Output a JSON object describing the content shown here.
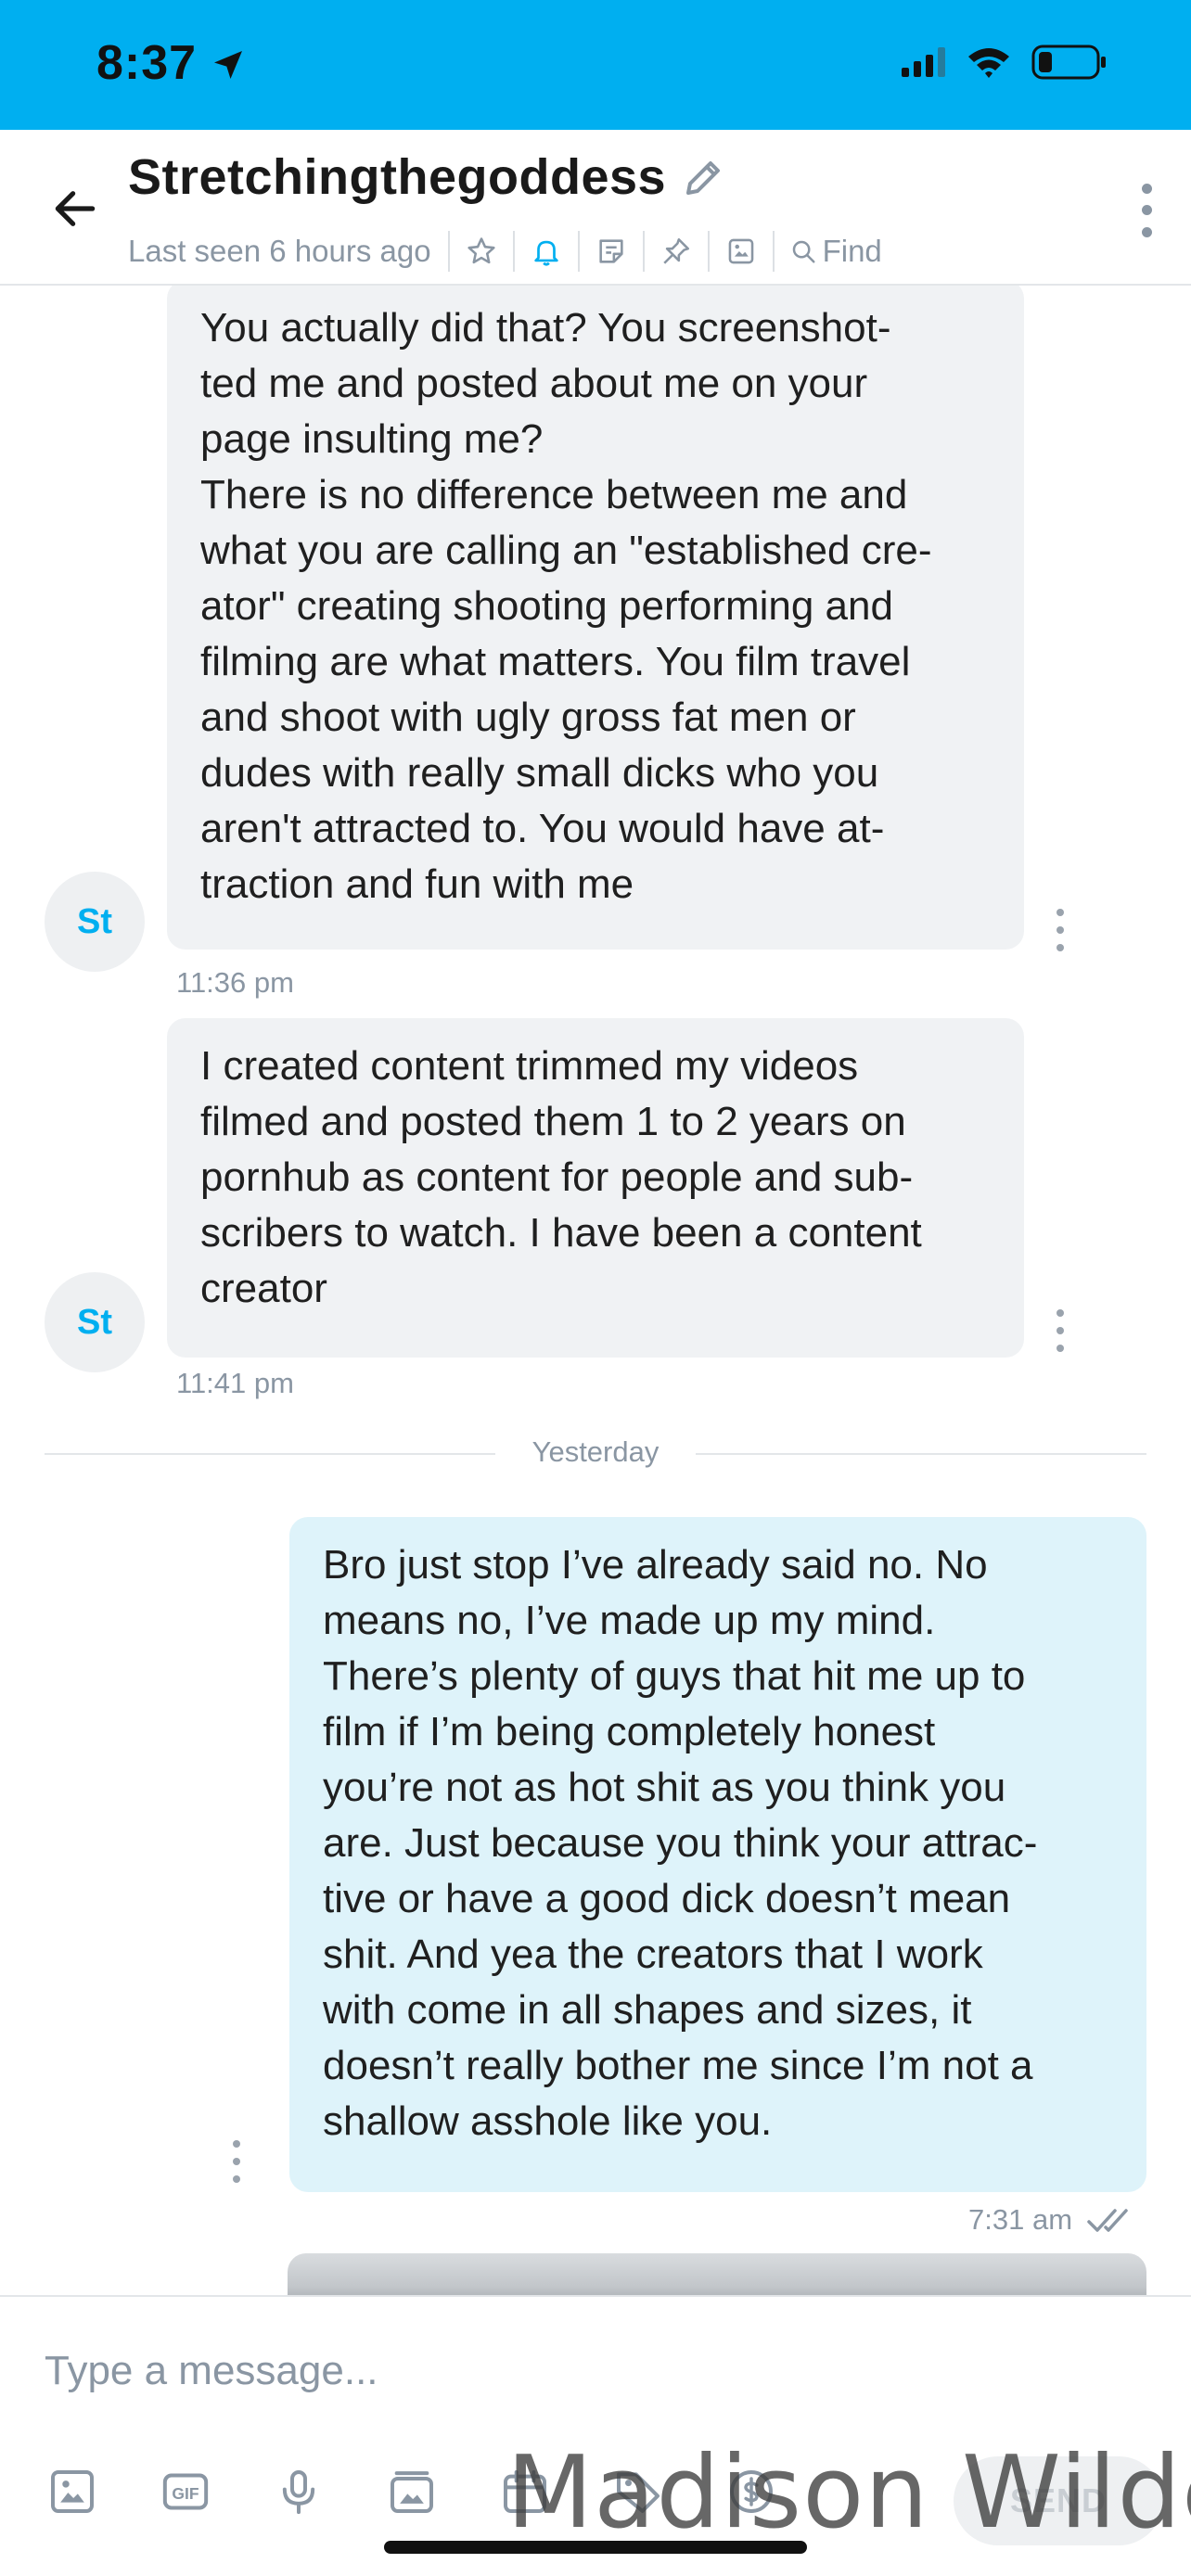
{
  "status_bar": {
    "time": "8:37"
  },
  "header": {
    "title": "Stretchingthegoddess",
    "last_seen": "Last seen 6 hours ago",
    "find_label": "Find"
  },
  "messages": [
    {
      "direction": "in",
      "avatar_initials": "St",
      "text": "You actually did that? You screenshot-\nted me and posted about me on your\npage insulting me?\nThere is no difference between me and\nwhat you are calling an \"established cre-\nator\" creating shooting performing and\nfilming are what matters. You film travel\nand shoot with ugly gross fat men or\ndudes with really small dicks who you\naren't attracted to. You would have at-\ntraction and fun with me",
      "time": "11:36 pm"
    },
    {
      "direction": "in",
      "avatar_initials": "St",
      "text": "I created content trimmed my videos\nfilmed and posted them 1 to 2 years on\npornhub as content for people and sub-\nscribers to watch. I have been a content\ncreator",
      "time": "11:41 pm"
    },
    {
      "direction": "out",
      "text": "Bro just stop I’ve already said no. No\nmeans no, I’ve made up my mind.\nThere’s plenty of guys that hit me up to\nfilm if I’m being completely honest\nyou’re not as hot shit as you think you\nare. Just because you think your attrac-\ntive or have a good dick doesn’t mean\nshit. And yea the creators that I work\nwith come in all shapes and sizes, it\ndoesn’t really bother me since I’m not a\nshallow asshole like you.",
      "time": "7:31 am"
    }
  ],
  "date_divider": "Yesterday",
  "composer": {
    "placeholder": "Type a message...",
    "send_label": "SEND"
  },
  "watermark": "Madison Wilde",
  "colors": {
    "accent": "#00aff0",
    "incoming_bubble": "#f0f2f4",
    "outgoing_bubble": "#def3fa",
    "muted_text": "#8a96a3"
  },
  "icons": [
    "back-arrow-icon",
    "edit-pencil-icon",
    "star-icon",
    "bell-icon",
    "note-icon",
    "pin-icon",
    "image-icon",
    "search-icon",
    "more-vertical-icon",
    "location-arrow-icon",
    "signal-icon",
    "wifi-icon",
    "battery-icon",
    "gif-icon",
    "microphone-icon",
    "vault-icon",
    "calendar-icon",
    "price-tag-icon",
    "tip-icon",
    "double-check-icon"
  ]
}
